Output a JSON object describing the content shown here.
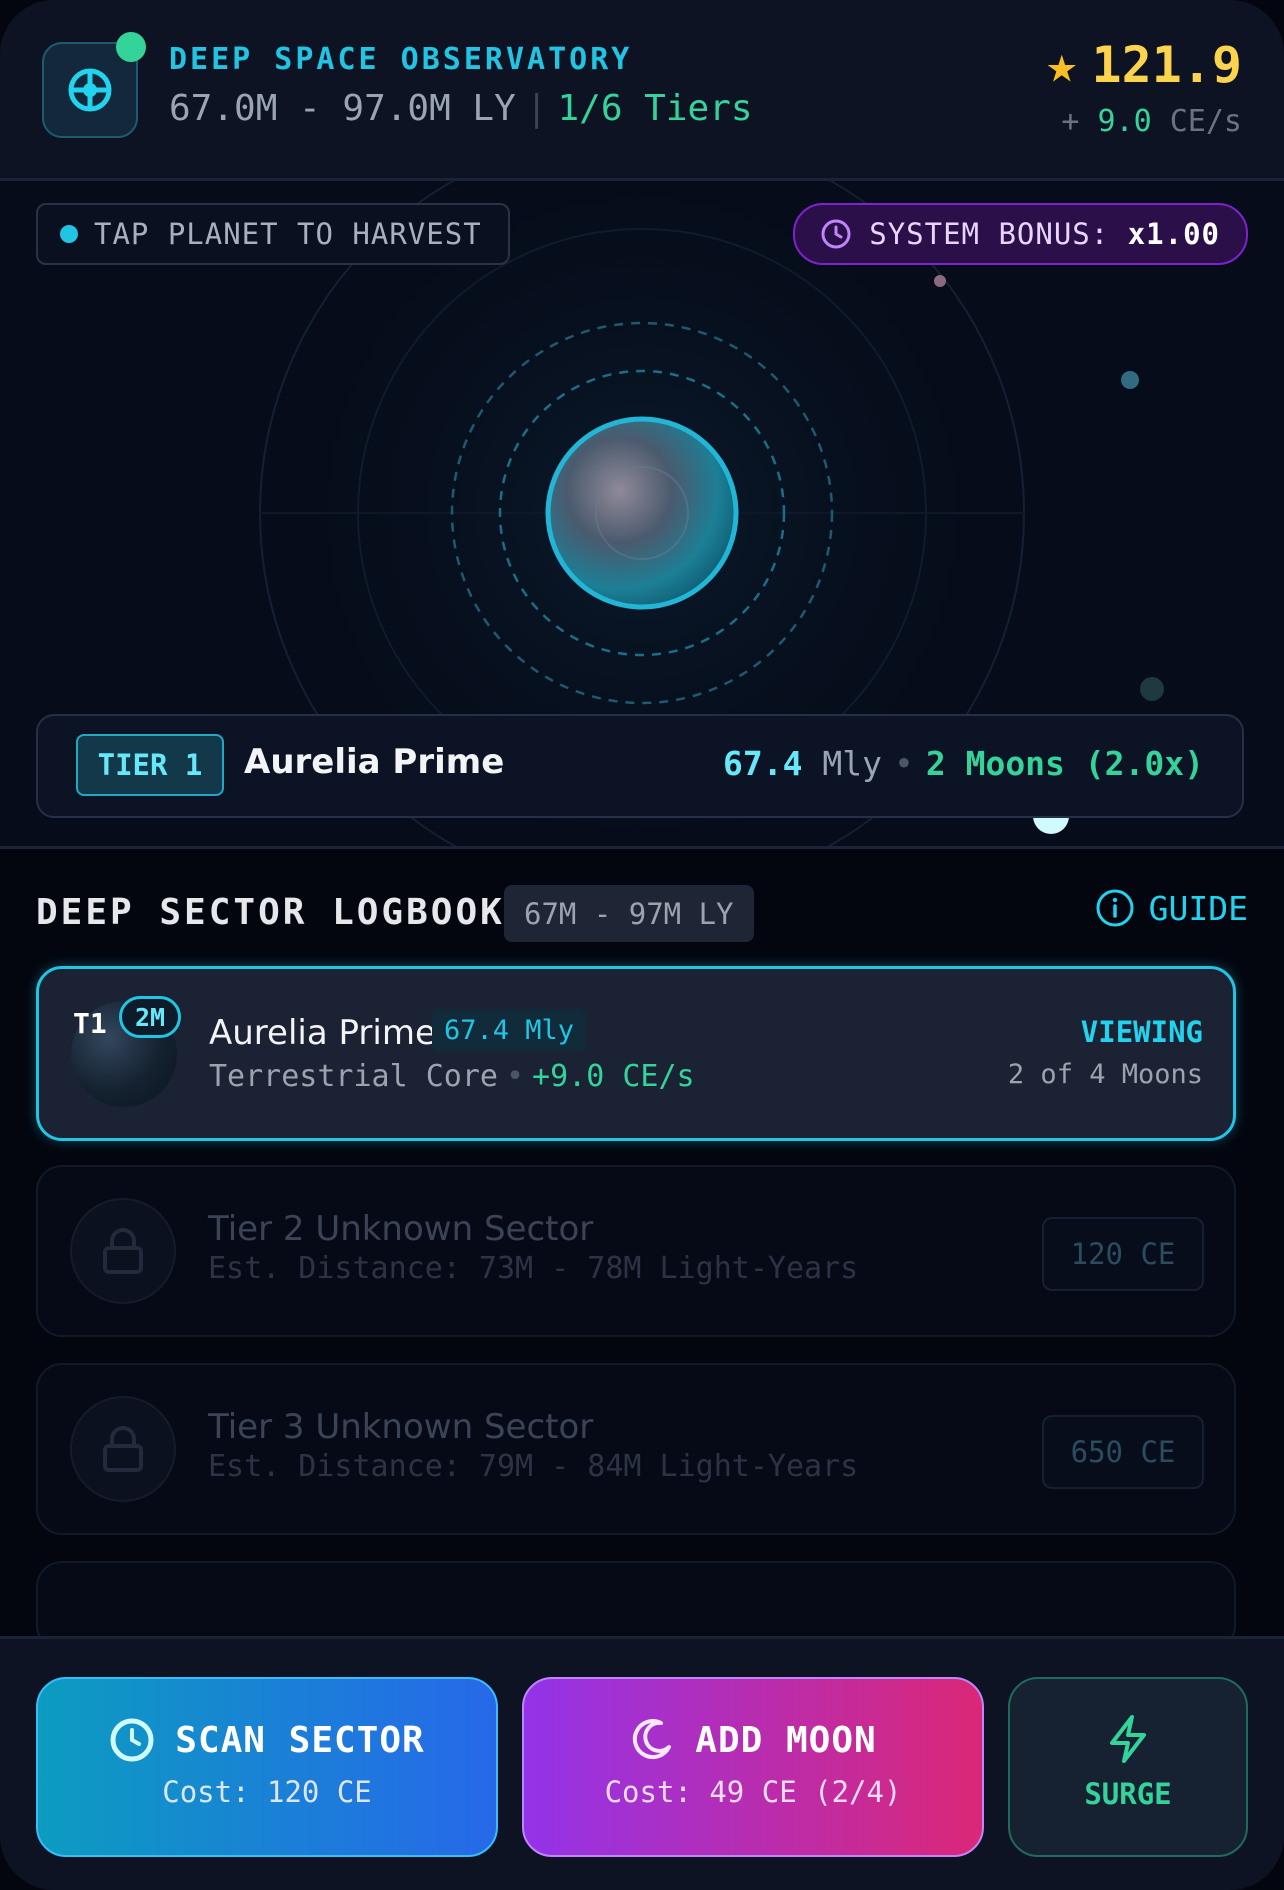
{
  "header": {
    "title": "DEEP SPACE OBSERVATORY",
    "range": "67.0M - 97.0M LY",
    "separator": "|",
    "tiers": "1/6 Tiers",
    "score": "121.9",
    "rate_prefix": "+",
    "rate_value": "9.0",
    "rate_unit": "CE/s",
    "icons": {
      "app": "observatory-target-icon",
      "score": "star-icon"
    }
  },
  "viewport": {
    "hint": "TAP PLANET TO HARVEST",
    "bonus_label": "SYSTEM BONUS:",
    "bonus_value": "x1.00",
    "planet": {
      "tier": "TIER 1",
      "name": "Aurelia Prime",
      "distance": "67.4",
      "distance_unit": "Mly",
      "bullet": "•",
      "moons": "2 Moons (2.0x)"
    }
  },
  "logbook": {
    "title": "DEEP SECTOR LOGBOOK",
    "range": "67M - 97M LY",
    "guide": "GUIDE",
    "entries": [
      {
        "tier_short": "T1",
        "moon_badge": "2M",
        "name": "Aurelia Prime",
        "distance": "67.4 Mly",
        "type": "Terrestrial Core",
        "bullet": "•",
        "rate": "+9.0 CE/s",
        "status": "VIEWING",
        "moons": "2 of 4 Moons"
      },
      {
        "name": "Tier 2 Unknown Sector",
        "estimate": "Est. Distance: 73M - 78M Light-Years",
        "cost": "120 CE"
      },
      {
        "name": "Tier 3 Unknown Sector",
        "estimate": "Est. Distance: 79M - 84M Light-Years",
        "cost": "650 CE"
      }
    ]
  },
  "actions": {
    "scan": {
      "label": "SCAN SECTOR",
      "cost": "Cost: 120 CE"
    },
    "moon": {
      "label": "ADD MOON",
      "cost": "Cost: 49 CE (2/4)"
    },
    "surge": {
      "label": "SURGE"
    }
  },
  "colors": {
    "accent": "#22c4e3",
    "positive": "#34d399",
    "score": "#fcd34d",
    "bonus": "#7e22ce"
  }
}
